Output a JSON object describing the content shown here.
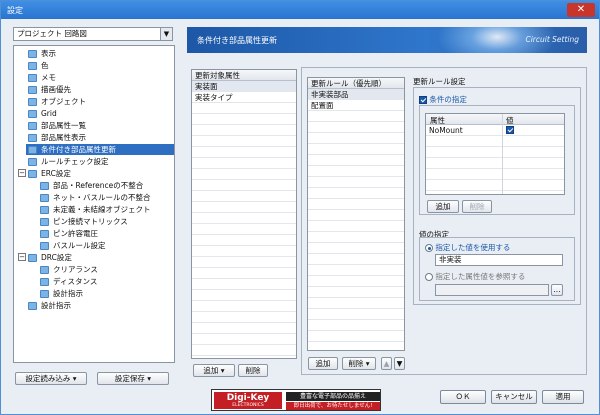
{
  "window": {
    "title": "設定",
    "close_icon": "close-icon"
  },
  "left": {
    "combo_value": "プロジェクト 回路図",
    "tree": [
      {
        "label": "表示"
      },
      {
        "label": "色"
      },
      {
        "label": "メモ"
      },
      {
        "label": "描画優先"
      },
      {
        "label": "オブジェクト"
      },
      {
        "label": "Grid"
      },
      {
        "label": "部品属性一覧"
      },
      {
        "label": "部品属性表示"
      },
      {
        "label": "条件付き部品属性更新",
        "selected": true
      },
      {
        "label": "ルールチェック設定"
      },
      {
        "label": "ERC設定",
        "expander": "−"
      },
      {
        "label": "部品・Referenceの不整合"
      },
      {
        "label": "ネット・バスルールの不整合"
      },
      {
        "label": "未定義・未結線オブジェクト"
      },
      {
        "label": "ピン接続マトリックス"
      },
      {
        "label": "ピン許容電圧"
      },
      {
        "label": "バスルール設定"
      },
      {
        "label": "DRC設定",
        "expander": "−"
      },
      {
        "label": "クリアランス"
      },
      {
        "label": "ディスタンス"
      },
      {
        "label": "設計指示"
      },
      {
        "label": "設計指示"
      }
    ],
    "load_button": "設定読み込み",
    "save_button": "設定保存"
  },
  "banner": {
    "title": "条件付き部品属性更新",
    "subtitle": "Circuit Setting"
  },
  "target_attr": {
    "header": "更新対象属性",
    "items": [
      "実装面",
      "実装タイプ"
    ],
    "add_button": "追加",
    "delete_button": "削除"
  },
  "rules": {
    "header": "更新ルール（優先順）",
    "items": [
      "非実装部品",
      "配置面"
    ],
    "add_button": "追加",
    "delete_button": "削除",
    "up_icon": "arrow-up-icon",
    "down_icon": "arrow-down-icon"
  },
  "rule_settings": {
    "group_label": "更新ルール設定",
    "condition_label": "条件の指定",
    "table_headers": [
      "属性",
      "値"
    ],
    "table_rows": [
      {
        "attr": "NoMount",
        "checked": true
      }
    ],
    "add_button": "追加",
    "delete_button": "削除",
    "value_group_label": "値の指定",
    "use_value_label": "指定した値を使用する",
    "value_input": "非実装",
    "ref_attr_label": "指定した属性値を参照する",
    "ref_button": "..."
  },
  "ad": {
    "logo": "Digi-Key",
    "logo_sub": "ELECTRONICS",
    "line1": "豊富な電子部品の品揃え",
    "line2": "即日出荷で、お待たせしません!"
  },
  "footer": {
    "ok": "ＯＫ",
    "cancel": "キャンセル",
    "apply": "適用"
  }
}
